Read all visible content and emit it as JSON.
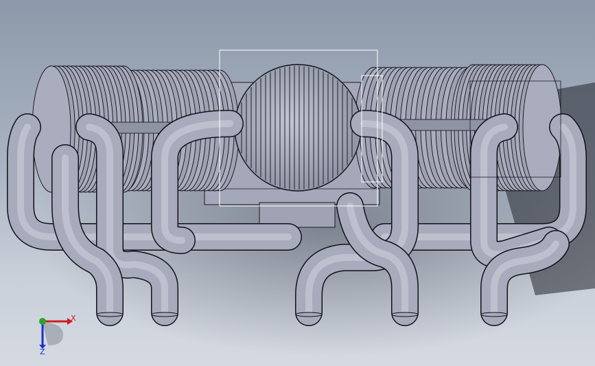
{
  "triad": {
    "x_label": "X",
    "z_label": "Z",
    "x_color": "#cc1f1f",
    "y_color": "#2aa32a",
    "z_color": "#1f2fcc"
  },
  "model": {
    "body_color": "#a7abbb",
    "pipe_color": "#a3a7b8",
    "edge_color": "#101018",
    "selection_box_color": "#ffffff"
  }
}
